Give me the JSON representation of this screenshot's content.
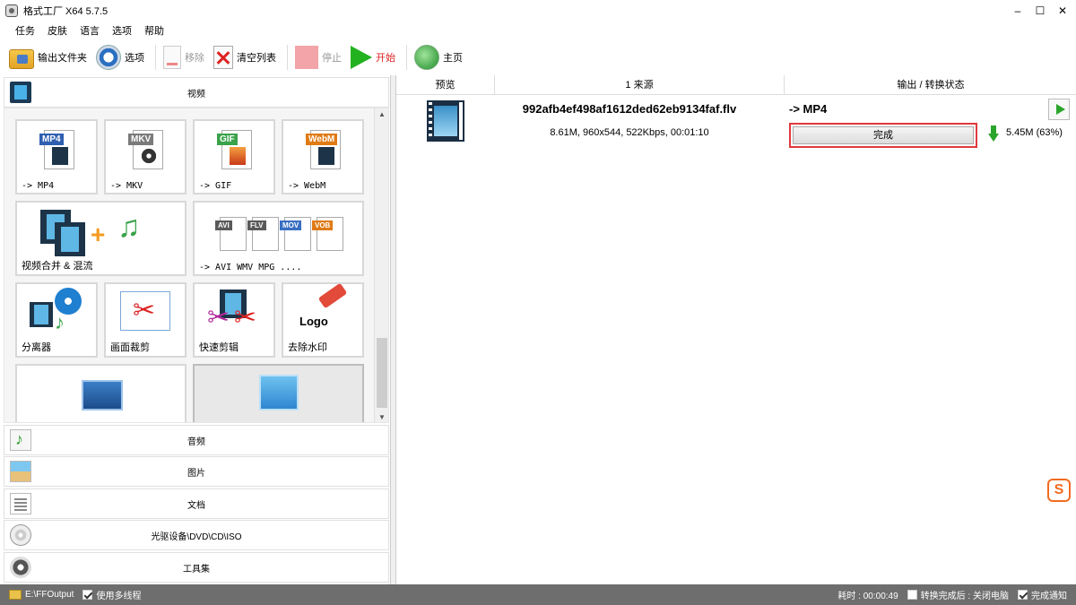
{
  "window": {
    "title": "格式工厂 X64 5.7.5",
    "min_label": "–",
    "max_label": "☐",
    "close_label": "✕"
  },
  "menu": [
    "任务",
    "皮肤",
    "语言",
    "选项",
    "帮助"
  ],
  "toolbar": {
    "output_folder": "输出文件夹",
    "options": "选项",
    "remove": "移除",
    "clear_list": "清空列表",
    "stop": "停止",
    "start": "开始",
    "home": "主页"
  },
  "left": {
    "video_header": "视频",
    "tiles": [
      {
        "label": "-> MP4",
        "badge": "MP4",
        "badge_color": "#2e5fb0"
      },
      {
        "label": "-> MKV",
        "badge": "MKV",
        "badge_color": "#7a7a7a"
      },
      {
        "label": "-> GIF",
        "badge": "GIF",
        "badge_color": "#3aa34a"
      },
      {
        "label": "-> WebM",
        "badge": "WebM",
        "badge_color": "#e07a14"
      },
      {
        "label": "视频合并 & 混流"
      },
      {
        "label": "-> AVI WMV MPG ....",
        "badges": [
          "AVI",
          "FLV",
          "MOV",
          "VOB"
        ]
      },
      {
        "label": "分离器"
      },
      {
        "label": "画面裁剪"
      },
      {
        "label": "快速剪辑"
      },
      {
        "label": "去除水印",
        "logo_text": "Logo"
      },
      {
        "label": ""
      },
      {
        "label": ""
      }
    ],
    "categories": [
      {
        "label": "音频",
        "icon": "audio-icon"
      },
      {
        "label": "图片",
        "icon": "picture-icon"
      },
      {
        "label": "文档",
        "icon": "document-icon"
      },
      {
        "label": "光驱设备\\DVD\\CD\\ISO",
        "icon": "disc-icon"
      },
      {
        "label": "工具集",
        "icon": "tools-icon"
      }
    ]
  },
  "list": {
    "columns": [
      "预览",
      "1 来源",
      "输出 / 转换状态"
    ],
    "rows": [
      {
        "source_name": "992afb4ef498af1612ded62eb9134faf.flv",
        "source_info": "8.61M, 960x544, 522Kbps, 00:01:10",
        "output_format": "-> MP4",
        "status": "完成",
        "output_size": "5.45M  (63%)"
      }
    ]
  },
  "statusbar": {
    "output_path": "E:\\FFOutput",
    "multithread": "使用多线程",
    "elapsed": "耗时 : 00:00:49",
    "after_convert": "转换完成后 : 关闭电脑",
    "notify": "完成通知"
  },
  "colors": {
    "status_highlight": "#e0393e",
    "accent_green": "#22b21f",
    "stop_red": "#f2a4a8"
  }
}
